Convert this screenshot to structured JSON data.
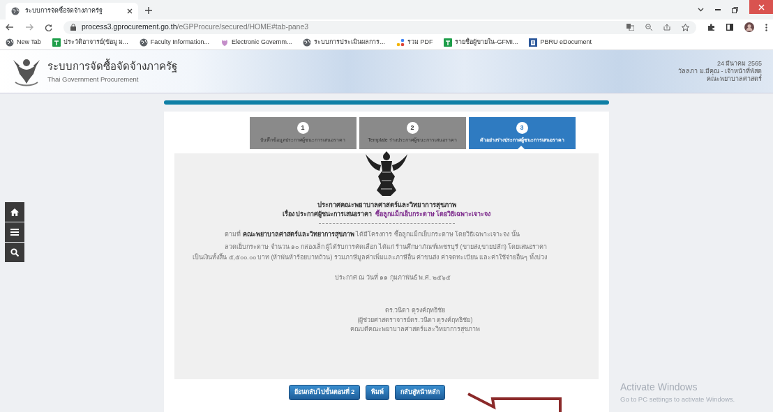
{
  "browser": {
    "tab": {
      "title": "ระบบการจัดซื้อจัดจ้างภาครัฐ",
      "selected": true
    },
    "address": {
      "host": "process3.gprocurement.go.th",
      "path": "/eGPProcure/secured/HOME#tab-pane3"
    },
    "bookmarks": [
      {
        "label": "New Tab",
        "kind": "globe"
      },
      {
        "label": "ประวัติอาจารย์(ข้อมู ม...",
        "kind": "sheet"
      },
      {
        "label": "Faculty Information...",
        "kind": "globe"
      },
      {
        "label": "Electronic Governm...",
        "kind": "shell"
      },
      {
        "label": "ระบบการประเมินผลการ...",
        "kind": "globe"
      },
      {
        "label": "รวม PDF",
        "kind": "dots"
      },
      {
        "label": "รายชื่อผู้ขายใน-GFMI...",
        "kind": "sheet"
      },
      {
        "label": "PBRU eDocument",
        "kind": "doc"
      }
    ]
  },
  "header": {
    "title": "ระบบการจัดซื้อจัดจ้างภาครัฐ",
    "subtitle": "Thai Government Procurement",
    "date": "24 มีนาคม 2565",
    "user": "วัลลภา ม.มีคุณ - เจ้าหน้าที่พัสดุ",
    "organization": "คณะพยาบาลศาสตร์"
  },
  "steps": [
    {
      "number": "1",
      "label": "บันทึกข้อมูลประกาศผู้ชนะการเสนอราคา",
      "selected": false
    },
    {
      "number": "2",
      "label": "Template ร่างประกาศผู้ชนะการเสนอราคา",
      "selected": false
    },
    {
      "number": "3",
      "label": "ตัวอย่างร่างประกาศผู้ชนะการเสนอราคา",
      "selected": true
    }
  ],
  "document": {
    "heading": "ประกาศคณะพยาบาลศาสตร์และวิทยาการสุขภาพ",
    "subject_label": "เรื่อง ประกาศผู้ชนะการเสนอราคา",
    "subject": "ซื้อลูกแม็กเย็บกระดาษ โดยวิธีเฉพาะเจาะจง",
    "paragraphs": [
      "ตามที่ **คณะพยาบาลศาสตร์และวิทยาการสุขภาพ** ได้มีโครงการ ซื้อลูกแม็กเย็บกระดาษ โดยวิธีเฉพาะเจาะจง  นั้น",
      "ลวดเย็บกระดาษ จำนวน ๑๐ กล่องเล็ก ผู้ได้รับการคัดเลือก ได้แก่ ร้านศึกษาภัณฑ์เพชรบุรี (ขายส่ง,ขายปลีก) โดยเสนอราคา เป็นเงินทั้งสิ้น ๕,๕๐๐.๐๐ บาท (ห้าพันห้าร้อยบาทถ้วน) รวมภาษีมูลค่าเพิ่มและภาษีอื่น ค่าขนส่ง ค่าจดทะเบียน และค่าใช้จ่ายอื่นๆ ทั้งปวง"
    ],
    "date_line": "ประกาศ ณ วันที่  ๑๑ กุมภาพันธ์ พ.ศ. ๒๕๖๕",
    "signature": [
      "ดร.วนิดา ดุรงค์ฤทธิชัย",
      "(ผู้ช่วยศาสตราจารย์ดร.วนิดา ดุรงค์ฤทธิชัย)",
      "คณบดีคณะพยาบาลศาสตร์และวิทยาการสุขภาพ"
    ]
  },
  "buttons": [
    "ย้อนกลับไปขั้นตอนที่ 2",
    "พิมพ์",
    "กลับสู่หน้าหลัก"
  ],
  "os_notice": {
    "title": "Activate Windows",
    "message": "Go to PC settings to activate Windows."
  }
}
